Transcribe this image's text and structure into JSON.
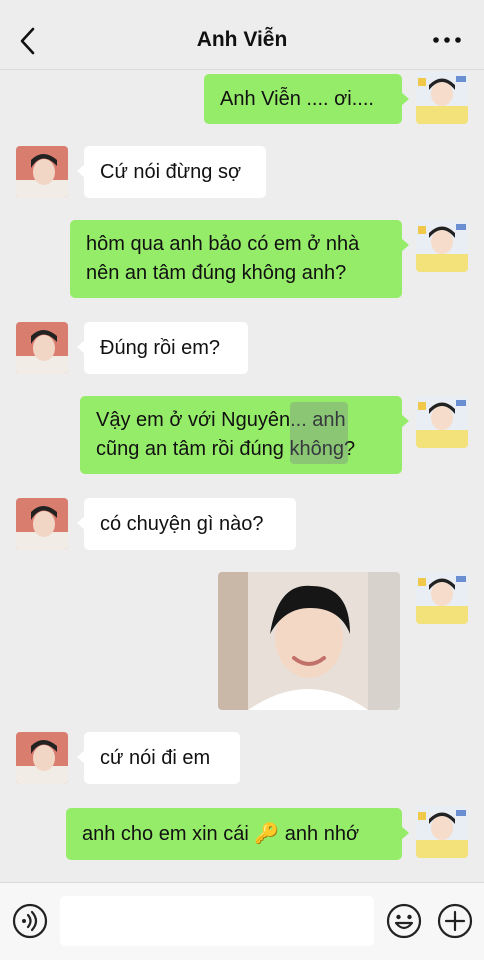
{
  "header": {
    "title": "Anh Viễn",
    "back_icon": "chevron-left-icon",
    "more_icon": "more-dots-icon"
  },
  "messages": [
    {
      "side": "me",
      "text": "Anh Viễn .... ơi...."
    },
    {
      "side": "other",
      "text": "Cứ nói đừng sợ"
    },
    {
      "side": "me",
      "text": "hôm qua anh bảo có em ở nhà nên an tâm đúng không anh?"
    },
    {
      "side": "other",
      "text": "Đúng rồi em?"
    },
    {
      "side": "me",
      "text": "Vậy em ở với Nguyên... anh cũng an tâm rồi đúng không?"
    },
    {
      "side": "other",
      "text": "có chuyện gì nào?"
    },
    {
      "side": "me",
      "type": "image",
      "text": ""
    },
    {
      "side": "other",
      "text": "cứ nói đi em"
    },
    {
      "side": "me",
      "text": "anh cho em xin cái 🔑 anh nhớ"
    }
  ],
  "input": {
    "voice_icon": "voice-icon",
    "emoji_icon": "emoji-icon",
    "plus_icon": "plus-icon",
    "placeholder": ""
  },
  "colors": {
    "background": "#ededed",
    "my_bubble": "#95ec69",
    "their_bubble": "#ffffff"
  }
}
